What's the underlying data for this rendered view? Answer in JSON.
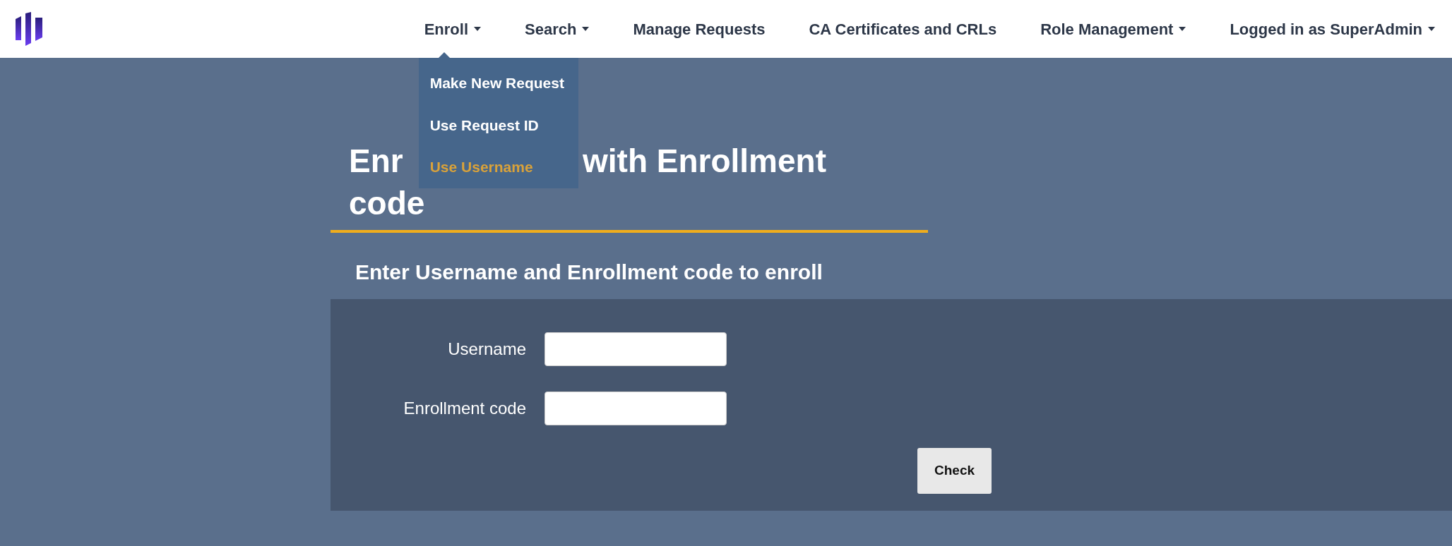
{
  "nav": {
    "items": [
      {
        "label": "Enroll",
        "has_menu": true,
        "open": true
      },
      {
        "label": "Search",
        "has_menu": true,
        "open": false
      },
      {
        "label": "Manage Requests",
        "has_menu": false,
        "open": false
      },
      {
        "label": "CA Certificates and CRLs",
        "has_menu": false,
        "open": false
      },
      {
        "label": "Role Management",
        "has_menu": true,
        "open": false
      },
      {
        "label": "Logged in as SuperAdmin",
        "has_menu": true,
        "open": false
      }
    ]
  },
  "dropdown": {
    "items": [
      {
        "label": "Make New Request",
        "selected": false
      },
      {
        "label": "Use Request ID",
        "selected": false
      },
      {
        "label": "Use Username",
        "selected": true
      }
    ]
  },
  "page": {
    "title_parts": [
      "Enr",
      "with Enrollment",
      "code"
    ],
    "subtitle": "Enter Username and Enrollment code to enroll"
  },
  "form": {
    "fields": [
      {
        "label": "Username"
      },
      {
        "label": "Enrollment code"
      }
    ],
    "button": "Check"
  }
}
